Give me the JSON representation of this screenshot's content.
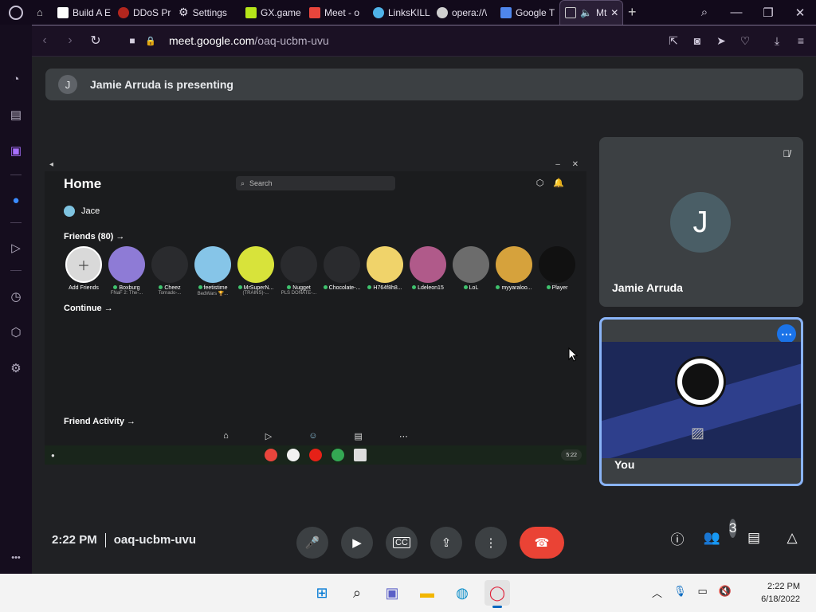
{
  "tabs": [
    {
      "label": "Build A E",
      "color": "#ffffff"
    },
    {
      "label": "DDoS Pr",
      "color": "#b3261e"
    },
    {
      "label": "Settings",
      "color": "#d0d0d0"
    },
    {
      "label": "GX.game",
      "color": "#b6e51a"
    },
    {
      "label": "Meet - o",
      "color": "#e8453c"
    },
    {
      "label": "LinksKILL",
      "color": "#4fb3e8"
    },
    {
      "label": "opera://\\",
      "color": "#d0d0d0"
    },
    {
      "label": "Google T",
      "color": "#4f86ec"
    },
    {
      "label": "Mt",
      "color": "#c060ff"
    }
  ],
  "address": {
    "host": "meet.google.com",
    "path": "/oaq-ucbm-uvu"
  },
  "banner": {
    "initial": "J",
    "text": "Jamie Arruda is presenting"
  },
  "shared": {
    "title": "Home",
    "search_placeholder": "Search",
    "username": "Jace",
    "friends_heading": "Friends (80) →",
    "friends": [
      {
        "name": "Add Friends",
        "sub": "",
        "online": false
      },
      {
        "name": "Boxburg",
        "sub": "FNaF 2: The-...",
        "online": true
      },
      {
        "name": "Cheez",
        "sub": "Tornado-...",
        "online": true
      },
      {
        "name": "feetistime",
        "sub": "BedWars 🏆...",
        "online": true
      },
      {
        "name": "MrSuperN...",
        "sub": "(TRAINS)-...",
        "online": true
      },
      {
        "name": "Nugget",
        "sub": "PLS DONATE-...",
        "online": true
      },
      {
        "name": "Chocolate-...",
        "sub": "",
        "online": true
      },
      {
        "name": "H764f8h8...",
        "sub": "",
        "online": true
      },
      {
        "name": "Ldeleon15",
        "sub": "",
        "online": true
      },
      {
        "name": "LoL",
        "sub": "",
        "online": true
      },
      {
        "name": "myyaraloo...",
        "sub": "",
        "online": true
      },
      {
        "name": "Player",
        "sub": "",
        "online": true
      }
    ],
    "continue_label": "Continue →",
    "activity_label": "Friend Activity →",
    "shelf_time": "5:22"
  },
  "participants": [
    {
      "initial": "J",
      "name": "Jamie Arruda"
    },
    {
      "name": "You"
    }
  ],
  "call": {
    "time": "2:22 PM",
    "code": "oaq-ucbm-uvu",
    "people_count": "3"
  },
  "taskbar": {
    "time": "2:22 PM",
    "date": "6/18/2022"
  }
}
